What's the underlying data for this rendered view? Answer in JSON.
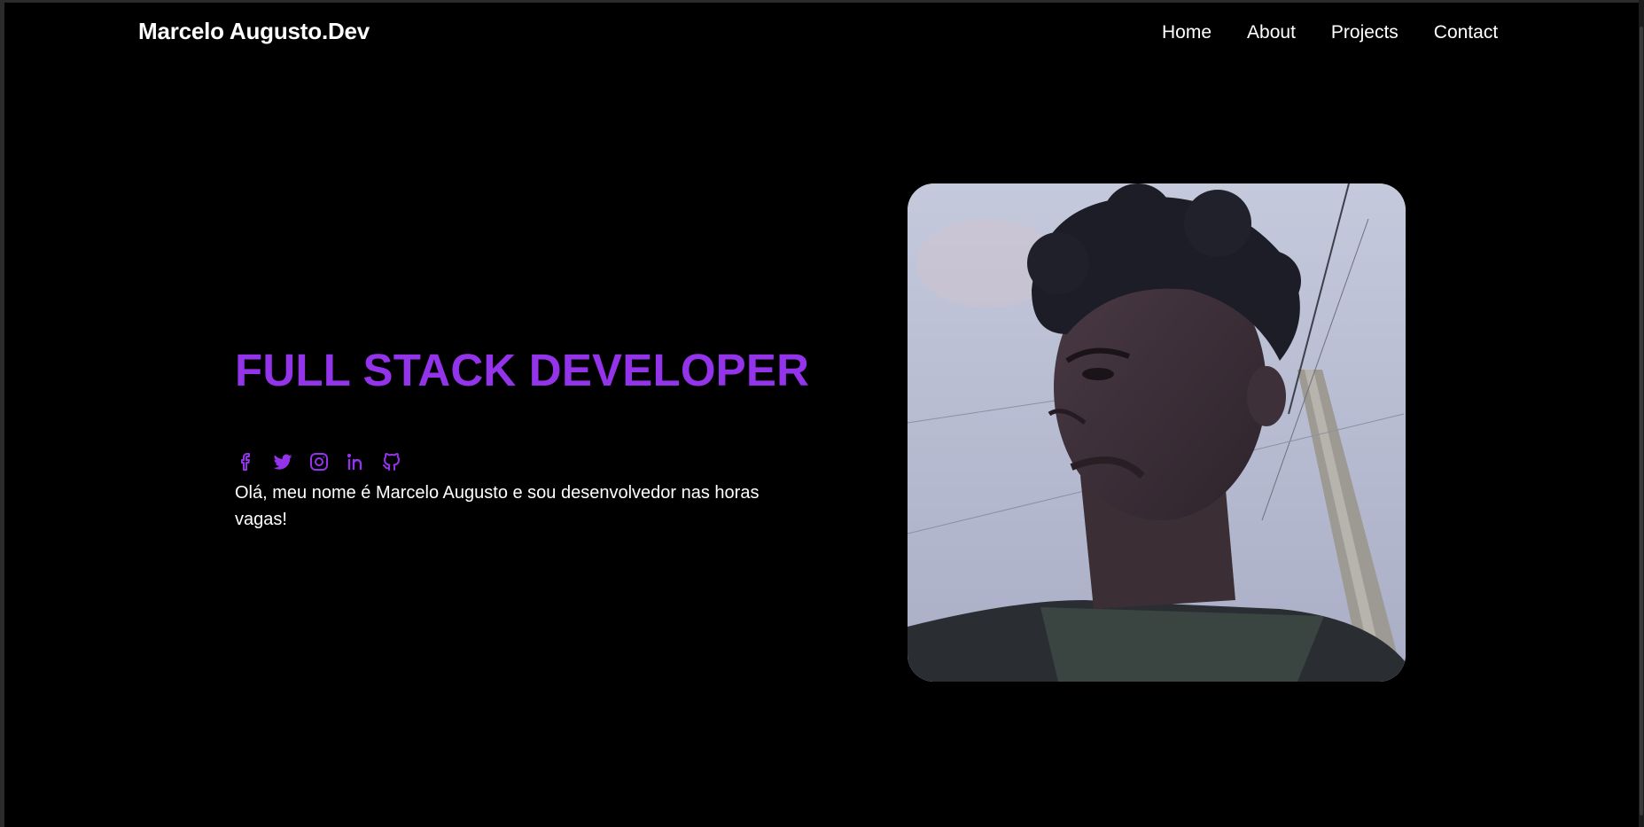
{
  "header": {
    "brand": "Marcelo Augusto.Dev",
    "nav": [
      {
        "label": "Home"
      },
      {
        "label": "About"
      },
      {
        "label": "Projects"
      },
      {
        "label": "Contact"
      }
    ]
  },
  "hero": {
    "title": "FULL STACK DEVELOPER",
    "intro": "Olá, meu nome é Marcelo Augusto e sou desenvolvedor nas horas vagas!",
    "socials": [
      {
        "icon": "facebook-icon"
      },
      {
        "icon": "twitter-icon"
      },
      {
        "icon": "instagram-icon"
      },
      {
        "icon": "linkedin-icon"
      },
      {
        "icon": "github-icon"
      }
    ]
  },
  "colors": {
    "background": "#000000",
    "accent": "#9333ea",
    "text": "#ffffff"
  }
}
